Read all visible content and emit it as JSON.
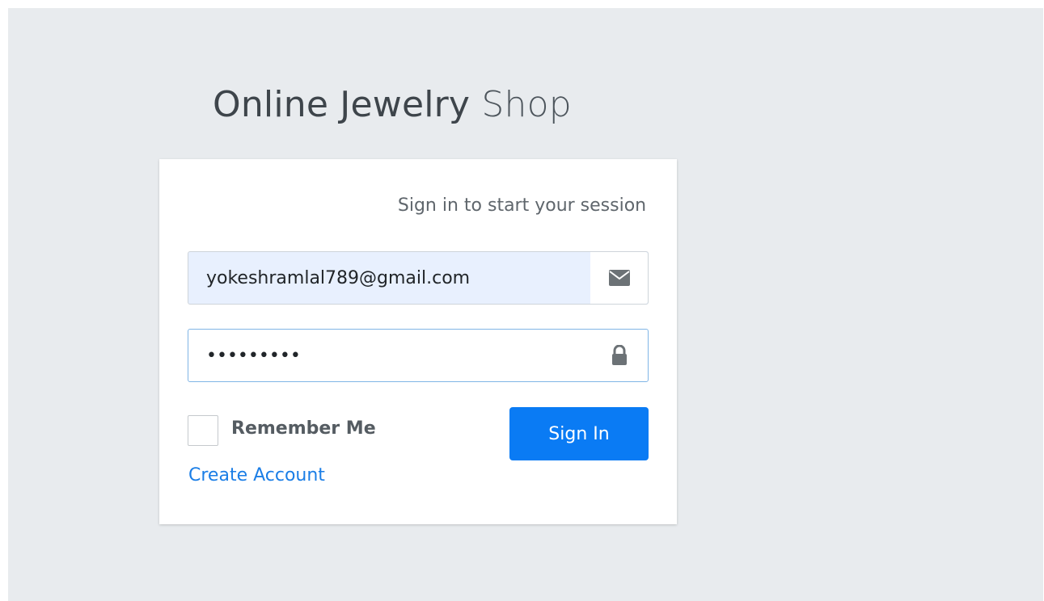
{
  "logo": {
    "primary": "Online Jewelry",
    "secondary": "Shop"
  },
  "login": {
    "message": "Sign in to start your session",
    "email_value": "yokeshramlal789@gmail.com",
    "password_value": "•••••••••",
    "remember_label": "Remember Me",
    "signin_label": "Sign In",
    "create_label": "Create Account"
  },
  "icons": {
    "email": "envelope-icon",
    "password": "lock-icon"
  },
  "colors": {
    "background": "#e8ebee",
    "primary_button": "#0a7bf4",
    "link": "#1b7ee6",
    "autofill": "#e8f0fe"
  }
}
